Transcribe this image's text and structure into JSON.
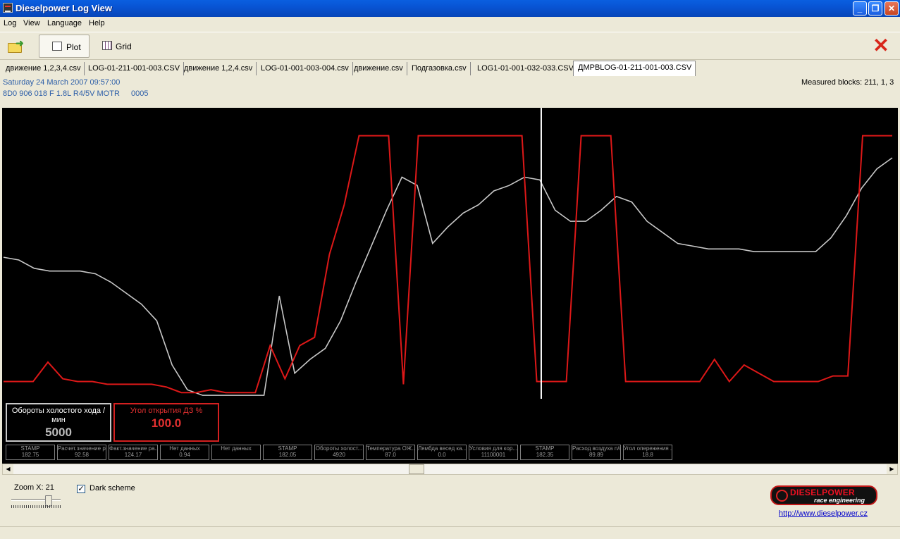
{
  "window": {
    "title": "Dieselpower Log View"
  },
  "menu": [
    "Log",
    "View",
    "Language",
    "Help"
  ],
  "toolbar": {
    "plot_label": "Plot",
    "grid_label": "Grid"
  },
  "tabs": [
    "движение 1,2,3,4.csv",
    "LOG-01-211-001-003.CSV",
    "движение 1,2,4.csv",
    "LOG-01-001-003-004.csv",
    "движение.csv",
    "Подгазовка.csv",
    "LOG1-01-001-032-033.CSV",
    "ДМРBLOG-01-211-001-003.CSV"
  ],
  "info": {
    "date": "Saturday 24 March 2007 09:57:00",
    "ecu": "8D0 906 018 F  1.8L R4/5V MOTR",
    "code": "0005",
    "measured": "Measured blocks: 211, 1, 3"
  },
  "colors": {
    "plot_bg": "#000000",
    "series_white": "#c8c8c8",
    "series_red": "#dd1818",
    "cursor": "#ffffff"
  },
  "cursor_position_index": 35,
  "chart_data": {
    "type": "line",
    "title": "",
    "xlabel": "",
    "ylabel": "",
    "ylim": [
      0,
      100
    ],
    "series": [
      {
        "name": "Обороты холостого хода /мин",
        "values": [
          51,
          50,
          47,
          46,
          46,
          46,
          45,
          42,
          38,
          34,
          28,
          12,
          3,
          1,
          1,
          1,
          1,
          1,
          37,
          9,
          14,
          18,
          28,
          42,
          55,
          68,
          80,
          77,
          56,
          62,
          67,
          70,
          75,
          77,
          80,
          79,
          68,
          64,
          64,
          68,
          73,
          71,
          64,
          60,
          56,
          55,
          54,
          54,
          54,
          53,
          53,
          53,
          53,
          53,
          58,
          66,
          76,
          83,
          87
        ]
      },
      {
        "name": "Угол открытия ДЗ %",
        "values": [
          6,
          6,
          6,
          13,
          7,
          6,
          6,
          5,
          5,
          5,
          5,
          4,
          2,
          2,
          3,
          2,
          2,
          2,
          19,
          7,
          19,
          22,
          52,
          70,
          95,
          95,
          95,
          5,
          95,
          95,
          95,
          95,
          95,
          95,
          95,
          95,
          6,
          6,
          6,
          95,
          95,
          95,
          6,
          6,
          6,
          6,
          6,
          6,
          14,
          6,
          12,
          9,
          6,
          6,
          6,
          6,
          8,
          8,
          95,
          95,
          95
        ]
      }
    ]
  },
  "readouts": [
    {
      "name": "Обороты холостого хода /мин",
      "value": "5000"
    },
    {
      "name": "Угол открытия ДЗ %",
      "value": "100.0"
    }
  ],
  "mini_readouts": [
    {
      "name": "STAMP",
      "value": "182.75"
    },
    {
      "name": "Расчет.значение ра...",
      "value": "92.58"
    },
    {
      "name": "Факт.значение ра...",
      "value": "124.17"
    },
    {
      "name": "Нет данных",
      "value": "0.94"
    },
    {
      "name": "Нет данных",
      "value": ""
    },
    {
      "name": "STAMP",
      "value": "182.05"
    },
    {
      "name": "Обороты холост...",
      "value": "4920"
    },
    {
      "name": "Температура ОЖ...",
      "value": "87.0"
    },
    {
      "name": "Лямбда весед ка...",
      "value": "0.0"
    },
    {
      "name": "Условия для кор...",
      "value": "11100001"
    },
    {
      "name": "STAMP",
      "value": "182.35"
    },
    {
      "name": "Расход воздуха n/c",
      "value": "89.89"
    },
    {
      "name": "Угол опережения ...",
      "value": "18.8"
    }
  ],
  "bottom": {
    "zoom_label": "Zoom X: 21",
    "zoom_value": 21,
    "dark_scheme_label": "Dark scheme",
    "dark_scheme_checked": true,
    "logo_text": "DIESELPOWER",
    "logo_subtext": "race engineering",
    "website": "http://www.dieselpower.cz"
  }
}
